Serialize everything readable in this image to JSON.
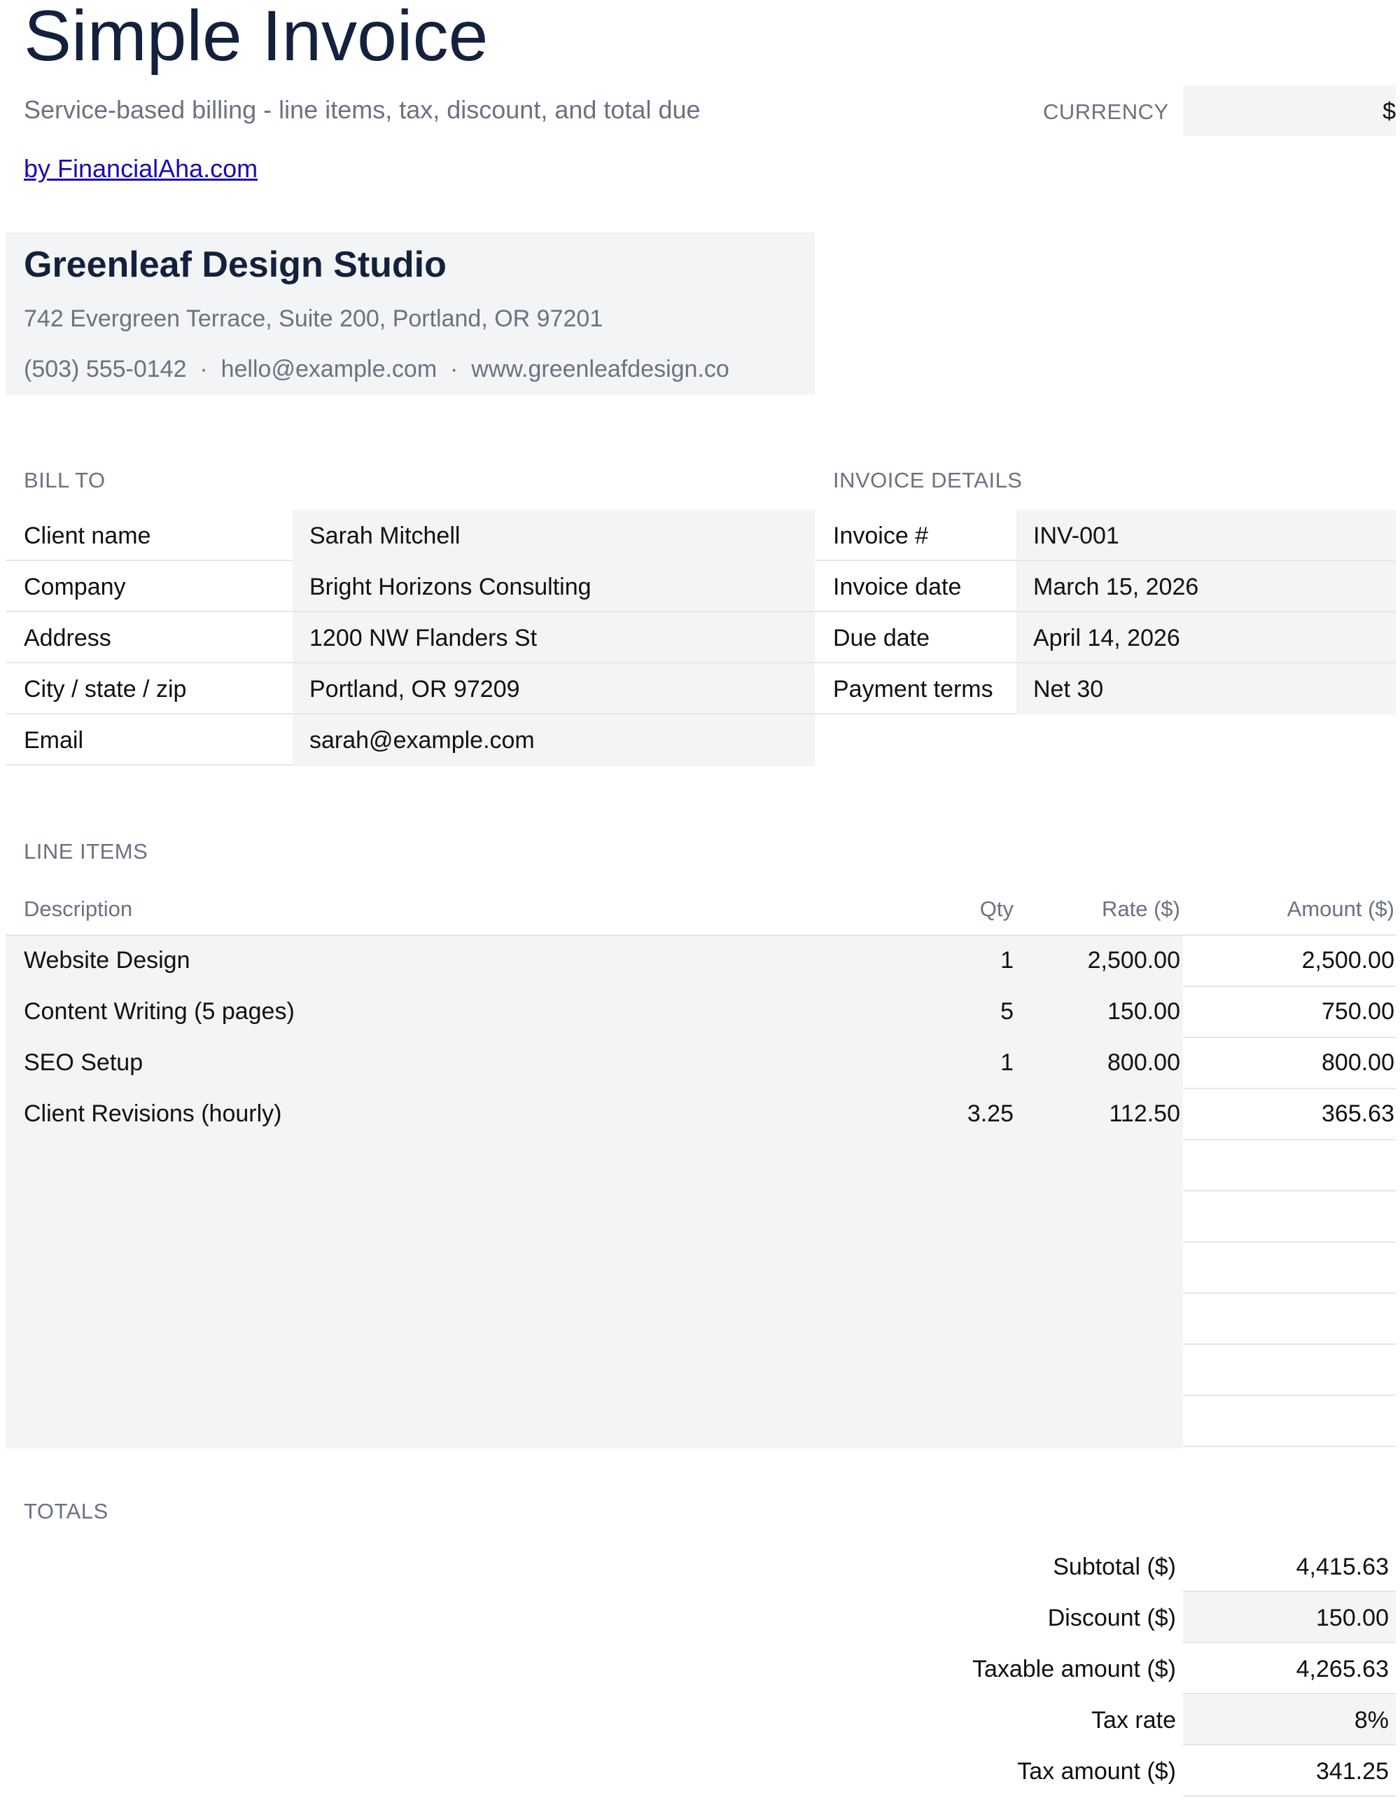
{
  "header": {
    "title": "Simple Invoice",
    "subtitle": "Service-based billing - line items, tax, discount, and total due",
    "credit_link": "by FinancialAha.com",
    "currency_label": "CURRENCY",
    "currency_value": "$"
  },
  "company": {
    "name": "Greenleaf Design Studio",
    "address": "742 Evergreen Terrace, Suite 200, Portland, OR 97201",
    "contact": "(503) 555-0142  ·  hello@example.com  ·  www.greenleafdesign.co"
  },
  "bill_to": {
    "heading": "BILL TO",
    "rows": [
      {
        "label": "Client name",
        "value": "Sarah Mitchell"
      },
      {
        "label": "Company",
        "value": "Bright Horizons Consulting"
      },
      {
        "label": "Address",
        "value": "1200 NW Flanders St"
      },
      {
        "label": "City / state / zip",
        "value": "Portland, OR 97209"
      },
      {
        "label": "Email",
        "value": "sarah@example.com"
      }
    ]
  },
  "invoice_details": {
    "heading": "INVOICE DETAILS",
    "rows": [
      {
        "label": "Invoice #",
        "value": "INV-001"
      },
      {
        "label": "Invoice date",
        "value": "March 15, 2026"
      },
      {
        "label": "Due date",
        "value": "April 14, 2026"
      },
      {
        "label": "Payment terms",
        "value": "Net 30"
      }
    ]
  },
  "line_items": {
    "heading": "LINE ITEMS",
    "columns": {
      "description": "Description",
      "qty": "Qty",
      "rate": "Rate ($)",
      "amount": "Amount ($)"
    },
    "rows": [
      {
        "description": "Website Design",
        "qty": "1",
        "rate": "2,500.00",
        "amount": "2,500.00"
      },
      {
        "description": "Content Writing (5 pages)",
        "qty": "5",
        "rate": "150.00",
        "amount": "750.00"
      },
      {
        "description": "SEO Setup",
        "qty": "1",
        "rate": "800.00",
        "amount": "800.00"
      },
      {
        "description": "Client Revisions (hourly)",
        "qty": "3.25",
        "rate": "112.50",
        "amount": "365.63"
      },
      {
        "description": "",
        "qty": "",
        "rate": "",
        "amount": ""
      },
      {
        "description": "",
        "qty": "",
        "rate": "",
        "amount": ""
      },
      {
        "description": "",
        "qty": "",
        "rate": "",
        "amount": ""
      },
      {
        "description": "",
        "qty": "",
        "rate": "",
        "amount": ""
      },
      {
        "description": "",
        "qty": "",
        "rate": "",
        "amount": ""
      },
      {
        "description": "",
        "qty": "",
        "rate": "",
        "amount": ""
      }
    ]
  },
  "totals": {
    "heading": "TOTALS",
    "rows": [
      {
        "label": "Subtotal ($)",
        "value": "4,415.63",
        "input": false
      },
      {
        "label": "Discount ($)",
        "value": "150.00",
        "input": true
      },
      {
        "label": "Taxable amount ($)",
        "value": "4,265.63",
        "input": false
      },
      {
        "label": "Tax rate",
        "value": "8%",
        "input": true
      },
      {
        "label": "Tax amount ($)",
        "value": "341.25",
        "input": false
      }
    ]
  },
  "colors": {
    "title": "#14213d",
    "muted": "#6b7280",
    "input_fill": "#f3f4f6",
    "rule": "#e5e7eb",
    "link": "#1a0dab"
  }
}
